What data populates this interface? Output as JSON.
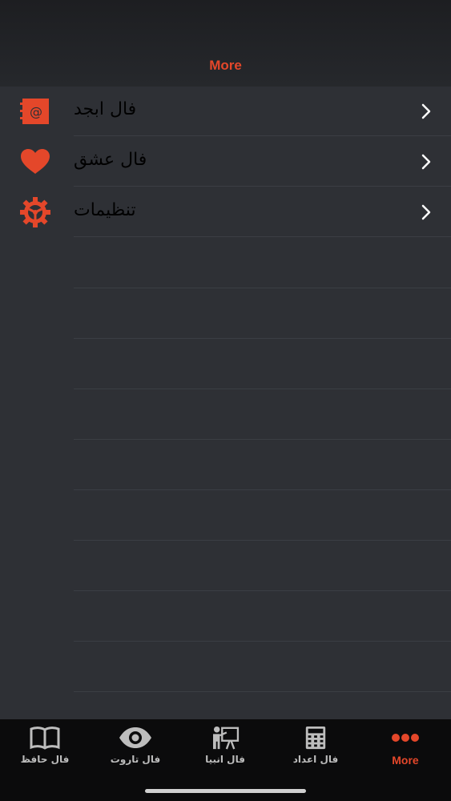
{
  "header": {
    "title": "More"
  },
  "menu": [
    {
      "label": "فال ابجد",
      "icon": "at-sign-notebook-icon"
    },
    {
      "label": "فال عشق",
      "icon": "heart-icon"
    },
    {
      "label": "تنظیمات",
      "icon": "gear-icon"
    }
  ],
  "tabs": [
    {
      "label": "فال حافظ",
      "icon": "book-icon"
    },
    {
      "label": "فال تاروت",
      "icon": "eye-icon"
    },
    {
      "label": "فال انبیا",
      "icon": "teacher-board-icon"
    },
    {
      "label": "فال اعداد",
      "icon": "calculator-icon"
    },
    {
      "label": "More",
      "icon": "more-dots-icon",
      "active": true
    }
  ],
  "colors": {
    "accent": "#e4472a",
    "background": "#2e3035",
    "tabbar": "#0b0b0c"
  }
}
